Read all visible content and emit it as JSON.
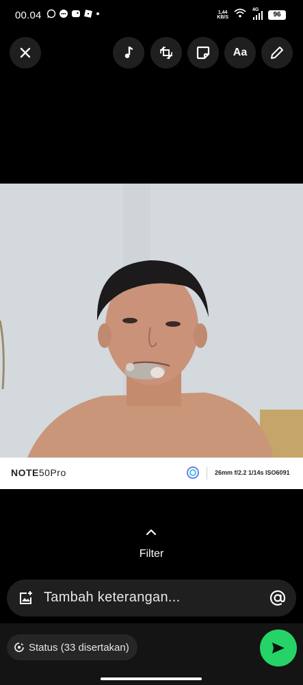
{
  "status_bar": {
    "time": "00.04",
    "net_speed_value": "1,44",
    "net_speed_unit": "KB/S",
    "signal_label": "4G",
    "battery": "96"
  },
  "toolbar": {
    "close_icon": "close-icon",
    "music_icon": "music-note-icon",
    "crop_icon": "crop-rotate-icon",
    "sticker_icon": "sticker-icon",
    "text_label": "Aa",
    "draw_icon": "pencil-icon"
  },
  "photo": {
    "watermark_brand_bold": "NOTE",
    "watermark_brand_model": "50Pro",
    "watermark_specs": "26mm f/2.2 1/14s ISO6091"
  },
  "filter": {
    "label": "Filter"
  },
  "caption": {
    "placeholder": "Tambah keterangan..."
  },
  "bottom": {
    "status_chip": "Status (33 disertakan)"
  },
  "colors": {
    "accent_green": "#25d366",
    "background": "#000000",
    "button_bg": "#1f1f1f"
  }
}
